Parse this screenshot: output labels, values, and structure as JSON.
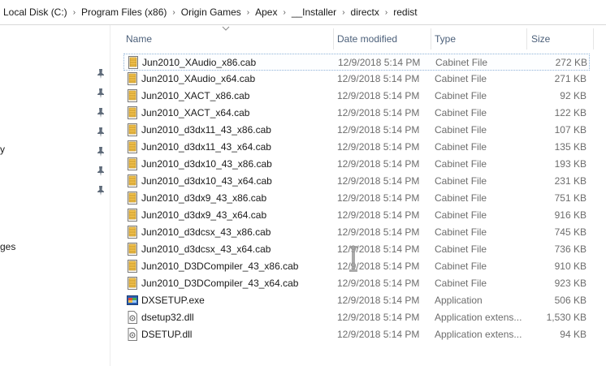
{
  "breadcrumb": [
    "Local Disk (C:)",
    "Program Files (x86)",
    "Origin Games",
    "Apex",
    "__Installer",
    "directx",
    "redist"
  ],
  "breadcrumb_separator": "›",
  "nav_pane": {
    "partial_items": [
      "y",
      "ges"
    ]
  },
  "columns": {
    "name": "Name",
    "date": "Date modified",
    "type": "Type",
    "size": "Size"
  },
  "files": [
    {
      "name": "Jun2010_XAudio_x86.cab",
      "date": "12/9/2018 5:14 PM",
      "type": "Cabinet File",
      "size": "272 KB",
      "icon": "cabinet-file-icon"
    },
    {
      "name": "Jun2010_XAudio_x64.cab",
      "date": "12/9/2018 5:14 PM",
      "type": "Cabinet File",
      "size": "271 KB",
      "icon": "cabinet-file-icon"
    },
    {
      "name": "Jun2010_XACT_x86.cab",
      "date": "12/9/2018 5:14 PM",
      "type": "Cabinet File",
      "size": "92 KB",
      "icon": "cabinet-file-icon"
    },
    {
      "name": "Jun2010_XACT_x64.cab",
      "date": "12/9/2018 5:14 PM",
      "type": "Cabinet File",
      "size": "122 KB",
      "icon": "cabinet-file-icon"
    },
    {
      "name": "Jun2010_d3dx11_43_x86.cab",
      "date": "12/9/2018 5:14 PM",
      "type": "Cabinet File",
      "size": "107 KB",
      "icon": "cabinet-file-icon"
    },
    {
      "name": "Jun2010_d3dx11_43_x64.cab",
      "date": "12/9/2018 5:14 PM",
      "type": "Cabinet File",
      "size": "135 KB",
      "icon": "cabinet-file-icon"
    },
    {
      "name": "Jun2010_d3dx10_43_x86.cab",
      "date": "12/9/2018 5:14 PM",
      "type": "Cabinet File",
      "size": "193 KB",
      "icon": "cabinet-file-icon"
    },
    {
      "name": "Jun2010_d3dx10_43_x64.cab",
      "date": "12/9/2018 5:14 PM",
      "type": "Cabinet File",
      "size": "231 KB",
      "icon": "cabinet-file-icon"
    },
    {
      "name": "Jun2010_d3dx9_43_x86.cab",
      "date": "12/9/2018 5:14 PM",
      "type": "Cabinet File",
      "size": "751 KB",
      "icon": "cabinet-file-icon"
    },
    {
      "name": "Jun2010_d3dx9_43_x64.cab",
      "date": "12/9/2018 5:14 PM",
      "type": "Cabinet File",
      "size": "916 KB",
      "icon": "cabinet-file-icon"
    },
    {
      "name": "Jun2010_d3dcsx_43_x86.cab",
      "date": "12/9/2018 5:14 PM",
      "type": "Cabinet File",
      "size": "745 KB",
      "icon": "cabinet-file-icon"
    },
    {
      "name": "Jun2010_d3dcsx_43_x64.cab",
      "date": "12/9/2018 5:14 PM",
      "type": "Cabinet File",
      "size": "736 KB",
      "icon": "cabinet-file-icon"
    },
    {
      "name": "Jun2010_D3DCompiler_43_x86.cab",
      "date": "12/9/2018 5:14 PM",
      "type": "Cabinet File",
      "size": "910 KB",
      "icon": "cabinet-file-icon"
    },
    {
      "name": "Jun2010_D3DCompiler_43_x64.cab",
      "date": "12/9/2018 5:14 PM",
      "type": "Cabinet File",
      "size": "923 KB",
      "icon": "cabinet-file-icon"
    },
    {
      "name": "DXSETUP.exe",
      "date": "12/9/2018 5:14 PM",
      "type": "Application",
      "size": "506 KB",
      "icon": "application-icon"
    },
    {
      "name": "dsetup32.dll",
      "date": "12/9/2018 5:14 PM",
      "type": "Application extens...",
      "size": "1,530 KB",
      "icon": "dll-file-icon"
    },
    {
      "name": "DSETUP.dll",
      "date": "12/9/2018 5:14 PM",
      "type": "Application extens...",
      "size": "94 KB",
      "icon": "dll-file-icon"
    }
  ],
  "selected_row_index": 0,
  "colors": {
    "header_text": "#4c607a",
    "secondary_text": "#6d6d6d",
    "selection_border": "#8fb3d9"
  }
}
